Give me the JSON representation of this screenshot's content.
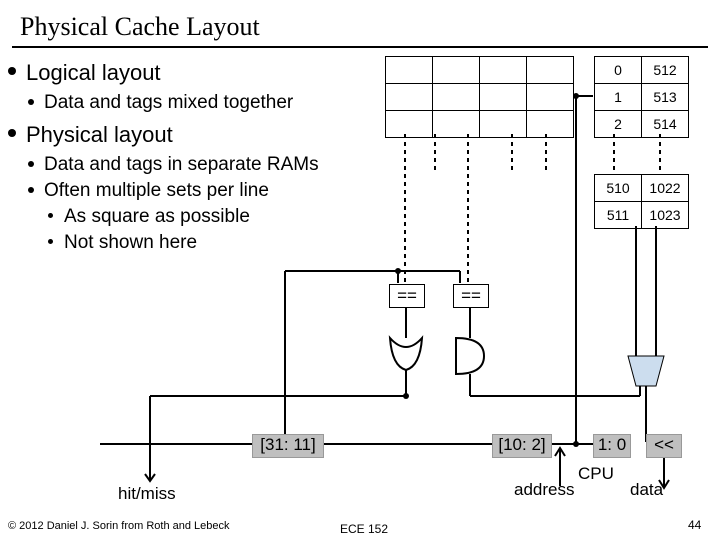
{
  "title": "Physical Cache Layout",
  "bullets": {
    "b1": "Logical layout",
    "b1s1": "Data and tags mixed together",
    "b2": "Physical layout",
    "b2s1": "Data and tags in separate RAMs",
    "b2s2": "Often multiple sets per line",
    "b2s2a": "As square as possible",
    "b2s2b": "Not shown here"
  },
  "bitfields": {
    "f1": "[31: 11]",
    "f2": "[10: 2]",
    "f3": "1: 0"
  },
  "compare": "==",
  "mux": "<<",
  "labels": {
    "hitmiss": "hit/miss",
    "cpu": "CPU",
    "address": "address",
    "data": "data"
  },
  "indices_left": {
    "r0": "0",
    "r1": "1",
    "r2": "2",
    "r3": "510",
    "r4": "511"
  },
  "indices_right": {
    "r0": "512",
    "r1": "513",
    "r2": "514",
    "r3": "1022",
    "r4": "1023"
  },
  "footer": {
    "copy": "© 2012 Daniel J. Sorin from Roth and Lebeck",
    "course": "ECE 152",
    "page": "44"
  }
}
